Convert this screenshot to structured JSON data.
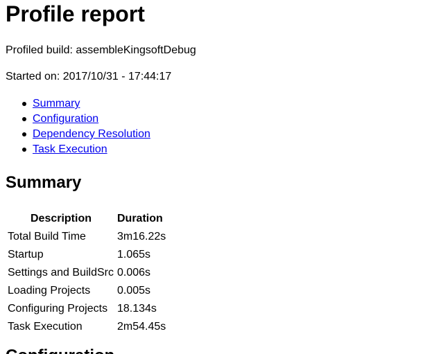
{
  "page": {
    "title": "Profile report",
    "build_line": "Profiled build: assembleKingsoftDebug",
    "started_line": "Started on: 2017/10/31 - 17:44:17"
  },
  "toc": {
    "items": [
      {
        "label": "Summary"
      },
      {
        "label": "Configuration"
      },
      {
        "label": "Dependency Resolution"
      },
      {
        "label": "Task Execution"
      }
    ]
  },
  "summary": {
    "heading": "Summary",
    "columns": {
      "description": "Description",
      "duration": "Duration"
    },
    "rows": [
      {
        "description": "Total Build Time",
        "duration": "3m16.22s"
      },
      {
        "description": "Startup",
        "duration": "1.065s"
      },
      {
        "description": "Settings and BuildSrc",
        "duration": "0.006s"
      },
      {
        "description": "Loading Projects",
        "duration": "0.005s"
      },
      {
        "description": "Configuring Projects",
        "duration": "18.134s"
      },
      {
        "description": "Task Execution",
        "duration": "2m54.45s"
      }
    ]
  },
  "configuration": {
    "heading": "Configuration"
  },
  "colors": {
    "link": "#0000ee",
    "text": "#000000",
    "background": "#ffffff"
  }
}
